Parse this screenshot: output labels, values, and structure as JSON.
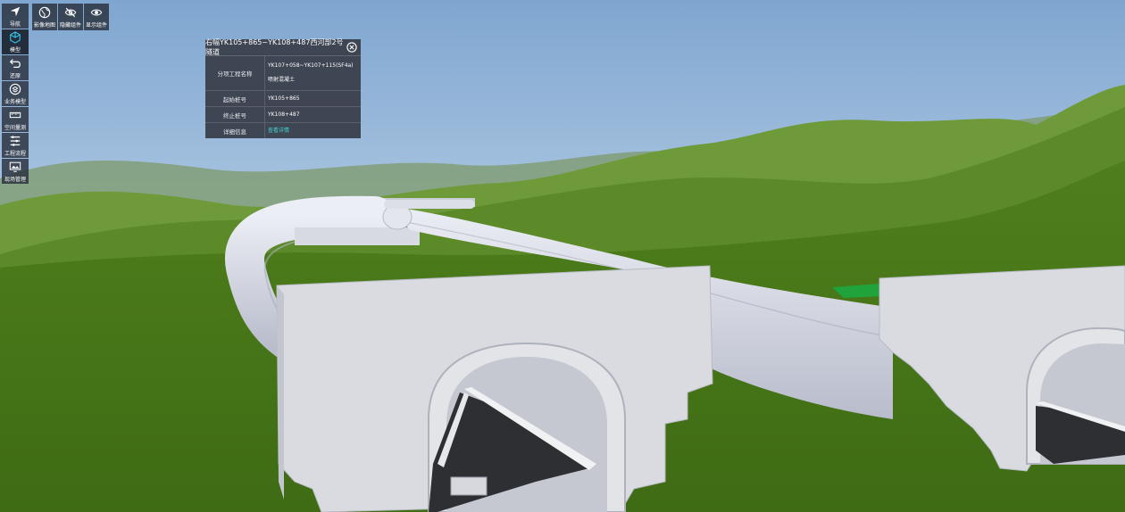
{
  "toolbar_left": [
    {
      "label": "导航",
      "icon": "navigation-arrow-icon",
      "active": false
    },
    {
      "label": "模型",
      "icon": "cube-icon",
      "active": true
    },
    {
      "label": "还原",
      "icon": "undo-icon",
      "active": false
    },
    {
      "label": "业务模型",
      "icon": "layers-icon",
      "active": false
    },
    {
      "label": "空间量测",
      "icon": "ruler-icon",
      "active": false
    },
    {
      "label": "工程流程",
      "icon": "process-list-icon",
      "active": false
    },
    {
      "label": "现场管理",
      "icon": "monitor-image-icon",
      "active": false
    }
  ],
  "toolbar_top": [
    {
      "label": "影像地图",
      "icon": "globe-icon"
    },
    {
      "label": "隐藏组件",
      "icon": "eye-off-icon"
    },
    {
      "label": "显示组件",
      "icon": "eye-icon"
    }
  ],
  "info_panel": {
    "title": "右幅YK105+865~YK108+487西河部2号隧道",
    "rows": [
      {
        "label": "分项工程名称",
        "value": "YK107+058~YK107+115(SF4a)喷射混凝土"
      },
      {
        "label": "起始桩号",
        "value": "YK105+865"
      },
      {
        "label": "终止桩号",
        "value": "YK108+487"
      },
      {
        "label": "详细信息",
        "value": "查看详情"
      }
    ]
  },
  "colors": {
    "toolbar_bg": "#283040",
    "panel_bg": "#373c48",
    "link": "#3fd6d0",
    "grass": "#4c7a1f",
    "tunnel": "#d6d8e0",
    "sky_top": "#7fa6d0"
  }
}
